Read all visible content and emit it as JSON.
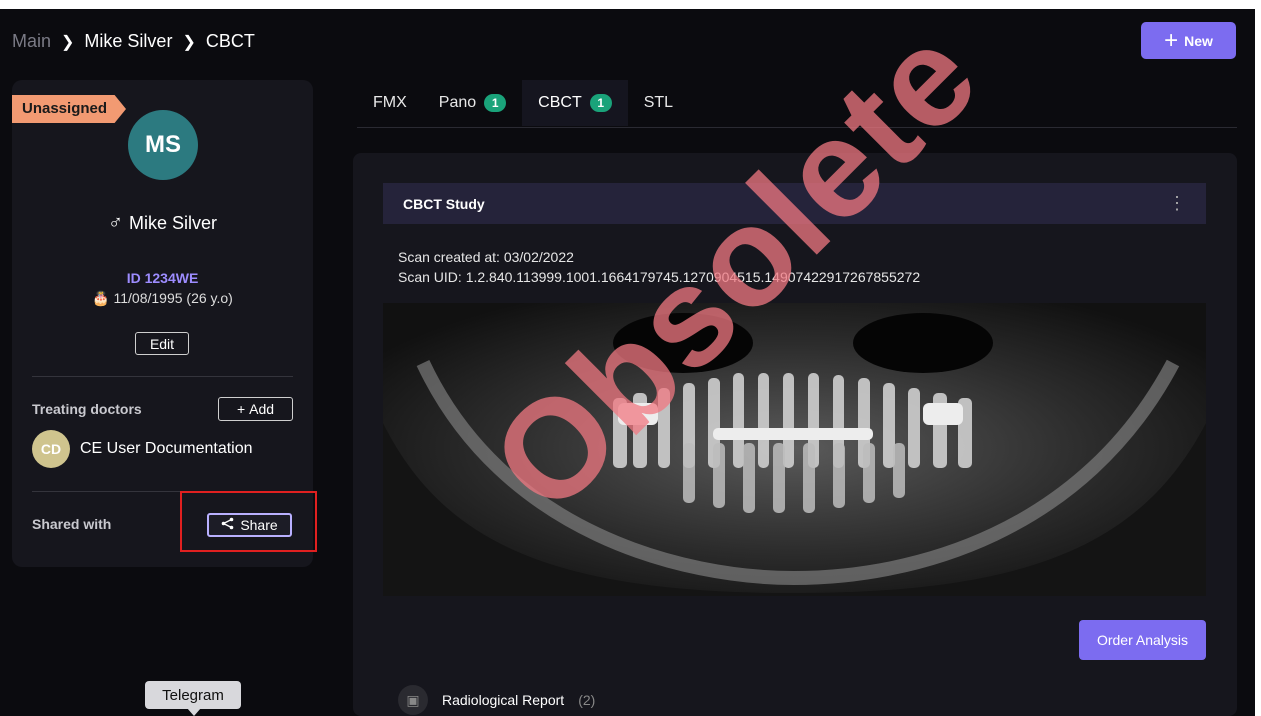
{
  "breadcrumb": {
    "root": "Main",
    "patient": "Mike Silver",
    "section": "CBCT"
  },
  "header": {
    "new_label": "New"
  },
  "patient": {
    "status_badge": "Unassigned",
    "initials": "MS",
    "gender_symbol": "♂",
    "name": "Mike Silver",
    "id": "ID 1234WE",
    "dob": "11/08/1995 (26 y.o)",
    "edit_label": "Edit"
  },
  "doctors": {
    "label": "Treating doctors",
    "add_label": "Add",
    "items": [
      {
        "initials": "CD",
        "name": "CE User Documentation"
      }
    ]
  },
  "shared": {
    "label": "Shared with",
    "share_label": "Share"
  },
  "tabs": [
    {
      "label": "FMX",
      "count": ""
    },
    {
      "label": "Pano",
      "count": "1"
    },
    {
      "label": "CBCT",
      "count": "1"
    },
    {
      "label": "STL",
      "count": ""
    }
  ],
  "study": {
    "title": "CBCT Study",
    "created": "Scan created at: 03/02/2022",
    "uid": "Scan UID: 1.2.840.113999.1001.1664179745.1270904515.1490742291726785527​2",
    "order_label": "Order Analysis",
    "report_label": "Radiological Report",
    "report_count": "(2)"
  },
  "tooltip": {
    "label": "Telegram"
  },
  "watermark": "Obsolete",
  "colors": {
    "accent": "#7c6cf0",
    "badge": "#f29a72",
    "tab_count": "#1aa37a",
    "highlight": "#e02020"
  }
}
